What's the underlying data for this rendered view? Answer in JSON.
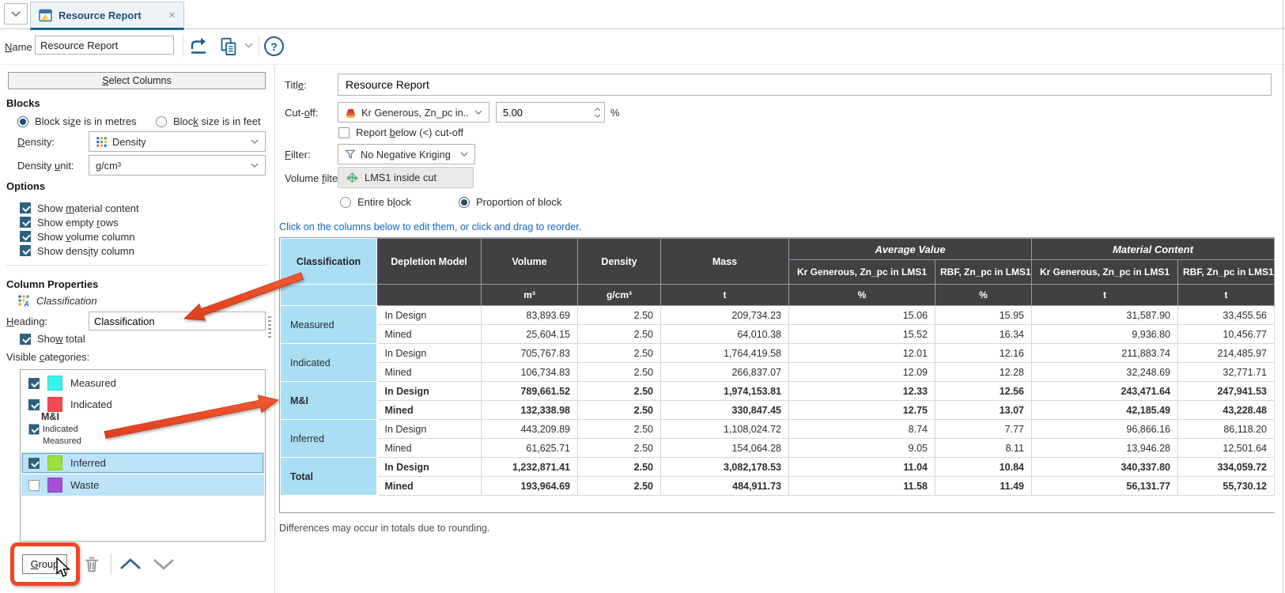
{
  "tab_bar": {
    "tab_title": "Resource Report",
    "close_glyph": "×"
  },
  "toolbar": {
    "name_label": "Name",
    "name_value": "Resource Report",
    "help_glyph": "?"
  },
  "left_panel": {
    "select_columns": "Select Columns",
    "blocks": {
      "heading": "Blocks",
      "radio_metres": "Block size is in metres",
      "radio_feet": "Block size is in feet",
      "density_label": "Density:",
      "density_value": "Density",
      "density_unit_label": "Density unit:",
      "density_unit_value": "g/cm³"
    },
    "options": {
      "heading": "Options",
      "items": [
        "Show material content",
        "Show empty rows",
        "Show volume column",
        "Show density column"
      ]
    },
    "column_properties": {
      "heading": "Column Properties",
      "column_name": "Classification",
      "heading_label": "Heading:",
      "heading_value": "Classification",
      "show_total": "Show total",
      "visible_categories_label": "Visible categories:",
      "categories": [
        {
          "label": "Measured",
          "color": "#3af2ee",
          "checked": true
        },
        {
          "label": "Indicated",
          "color": "#f4494f",
          "checked": true
        },
        {
          "group": "M&I",
          "children": [
            "Indicated",
            "Measured"
          ],
          "checked": true
        },
        {
          "label": "Inferred",
          "color": "#9ae13b",
          "checked": true,
          "selected": true
        },
        {
          "label": "Waste",
          "color": "#a54fd9",
          "checked": false,
          "selected": true
        }
      ],
      "group_button": "Group"
    }
  },
  "right_panel": {
    "title_label": "Title:",
    "title_value": "Resource Report",
    "cutoff_label": "Cut-off:",
    "cutoff_value": "Kr Generous, Zn_pc in...",
    "cutoff_percent": "5.00",
    "percent_sign": "%",
    "report_below": "Report below (<) cut-off",
    "filter_label": "Filter:",
    "filter_value": "No Negative Kriging",
    "volume_filter_label": "Volume filter:",
    "volume_filter_value": "LMS1 inside cut",
    "radio_entire": "Entire block",
    "radio_proportion": "Proportion of block",
    "hint": "Click on the columns below to edit them, or click and drag to reorder.",
    "footnote": "Differences may occur in totals due to rounding."
  },
  "report_table": {
    "columns": [
      "Classification",
      "Depletion Model",
      "Volume",
      "Density",
      "Mass"
    ],
    "group_headers": [
      "Average Value",
      "Material Content"
    ],
    "value_columns": [
      "Kr Generous, Zn_pc in LMS1",
      "RBF, Zn_pc in LMS1",
      "Kr Generous, Zn_pc in LMS1",
      "RBF, Zn_pc in LMS1"
    ],
    "units": [
      "",
      "",
      "m³",
      "g/cm³",
      "t",
      "%",
      "%",
      "t",
      "t"
    ],
    "groups": [
      {
        "classification": "Measured",
        "bold": false,
        "rows": [
          {
            "model": "In Design",
            "values": [
              "83,893.69",
              "2.50",
              "209,734.23",
              "15.06",
              "15.95",
              "31,587.90",
              "33,455.56"
            ]
          },
          {
            "model": "Mined",
            "values": [
              "25,604.15",
              "2.50",
              "64,010.38",
              "15.52",
              "16.34",
              "9,936.80",
              "10,456.77"
            ]
          }
        ]
      },
      {
        "classification": "Indicated",
        "bold": false,
        "rows": [
          {
            "model": "In Design",
            "values": [
              "705,767.83",
              "2.50",
              "1,764,419.58",
              "12.01",
              "12.16",
              "211,883.74",
              "214,485.97"
            ]
          },
          {
            "model": "Mined",
            "values": [
              "106,734.83",
              "2.50",
              "266,837.07",
              "12.09",
              "12.28",
              "32,248.69",
              "32,771.71"
            ]
          }
        ]
      },
      {
        "classification": "M&I",
        "bold": true,
        "rows": [
          {
            "model": "In Design",
            "values": [
              "789,661.52",
              "2.50",
              "1,974,153.81",
              "12.33",
              "12.56",
              "243,471.64",
              "247,941.53"
            ]
          },
          {
            "model": "Mined",
            "values": [
              "132,338.98",
              "2.50",
              "330,847.45",
              "12.75",
              "13.07",
              "42,185.49",
              "43,228.48"
            ]
          }
        ]
      },
      {
        "classification": "Inferred",
        "bold": false,
        "rows": [
          {
            "model": "In Design",
            "values": [
              "443,209.89",
              "2.50",
              "1,108,024.72",
              "8.74",
              "7.77",
              "96,866.16",
              "86,118.20"
            ]
          },
          {
            "model": "Mined",
            "values": [
              "61,625.71",
              "2.50",
              "154,064.28",
              "9.05",
              "8.11",
              "13,946.28",
              "12,501.64"
            ]
          }
        ]
      },
      {
        "classification": "Total",
        "bold": true,
        "rows": [
          {
            "model": "In Design",
            "values": [
              "1,232,871.41",
              "2.50",
              "3,082,178.53",
              "11.04",
              "10.84",
              "340,337.80",
              "334,059.72"
            ]
          },
          {
            "model": "Mined",
            "values": [
              "193,964.69",
              "2.50",
              "484,911.73",
              "11.58",
              "11.49",
              "56,131.77",
              "55,730.12"
            ]
          }
        ]
      }
    ]
  },
  "annotations": {
    "color": "#ed4726"
  }
}
